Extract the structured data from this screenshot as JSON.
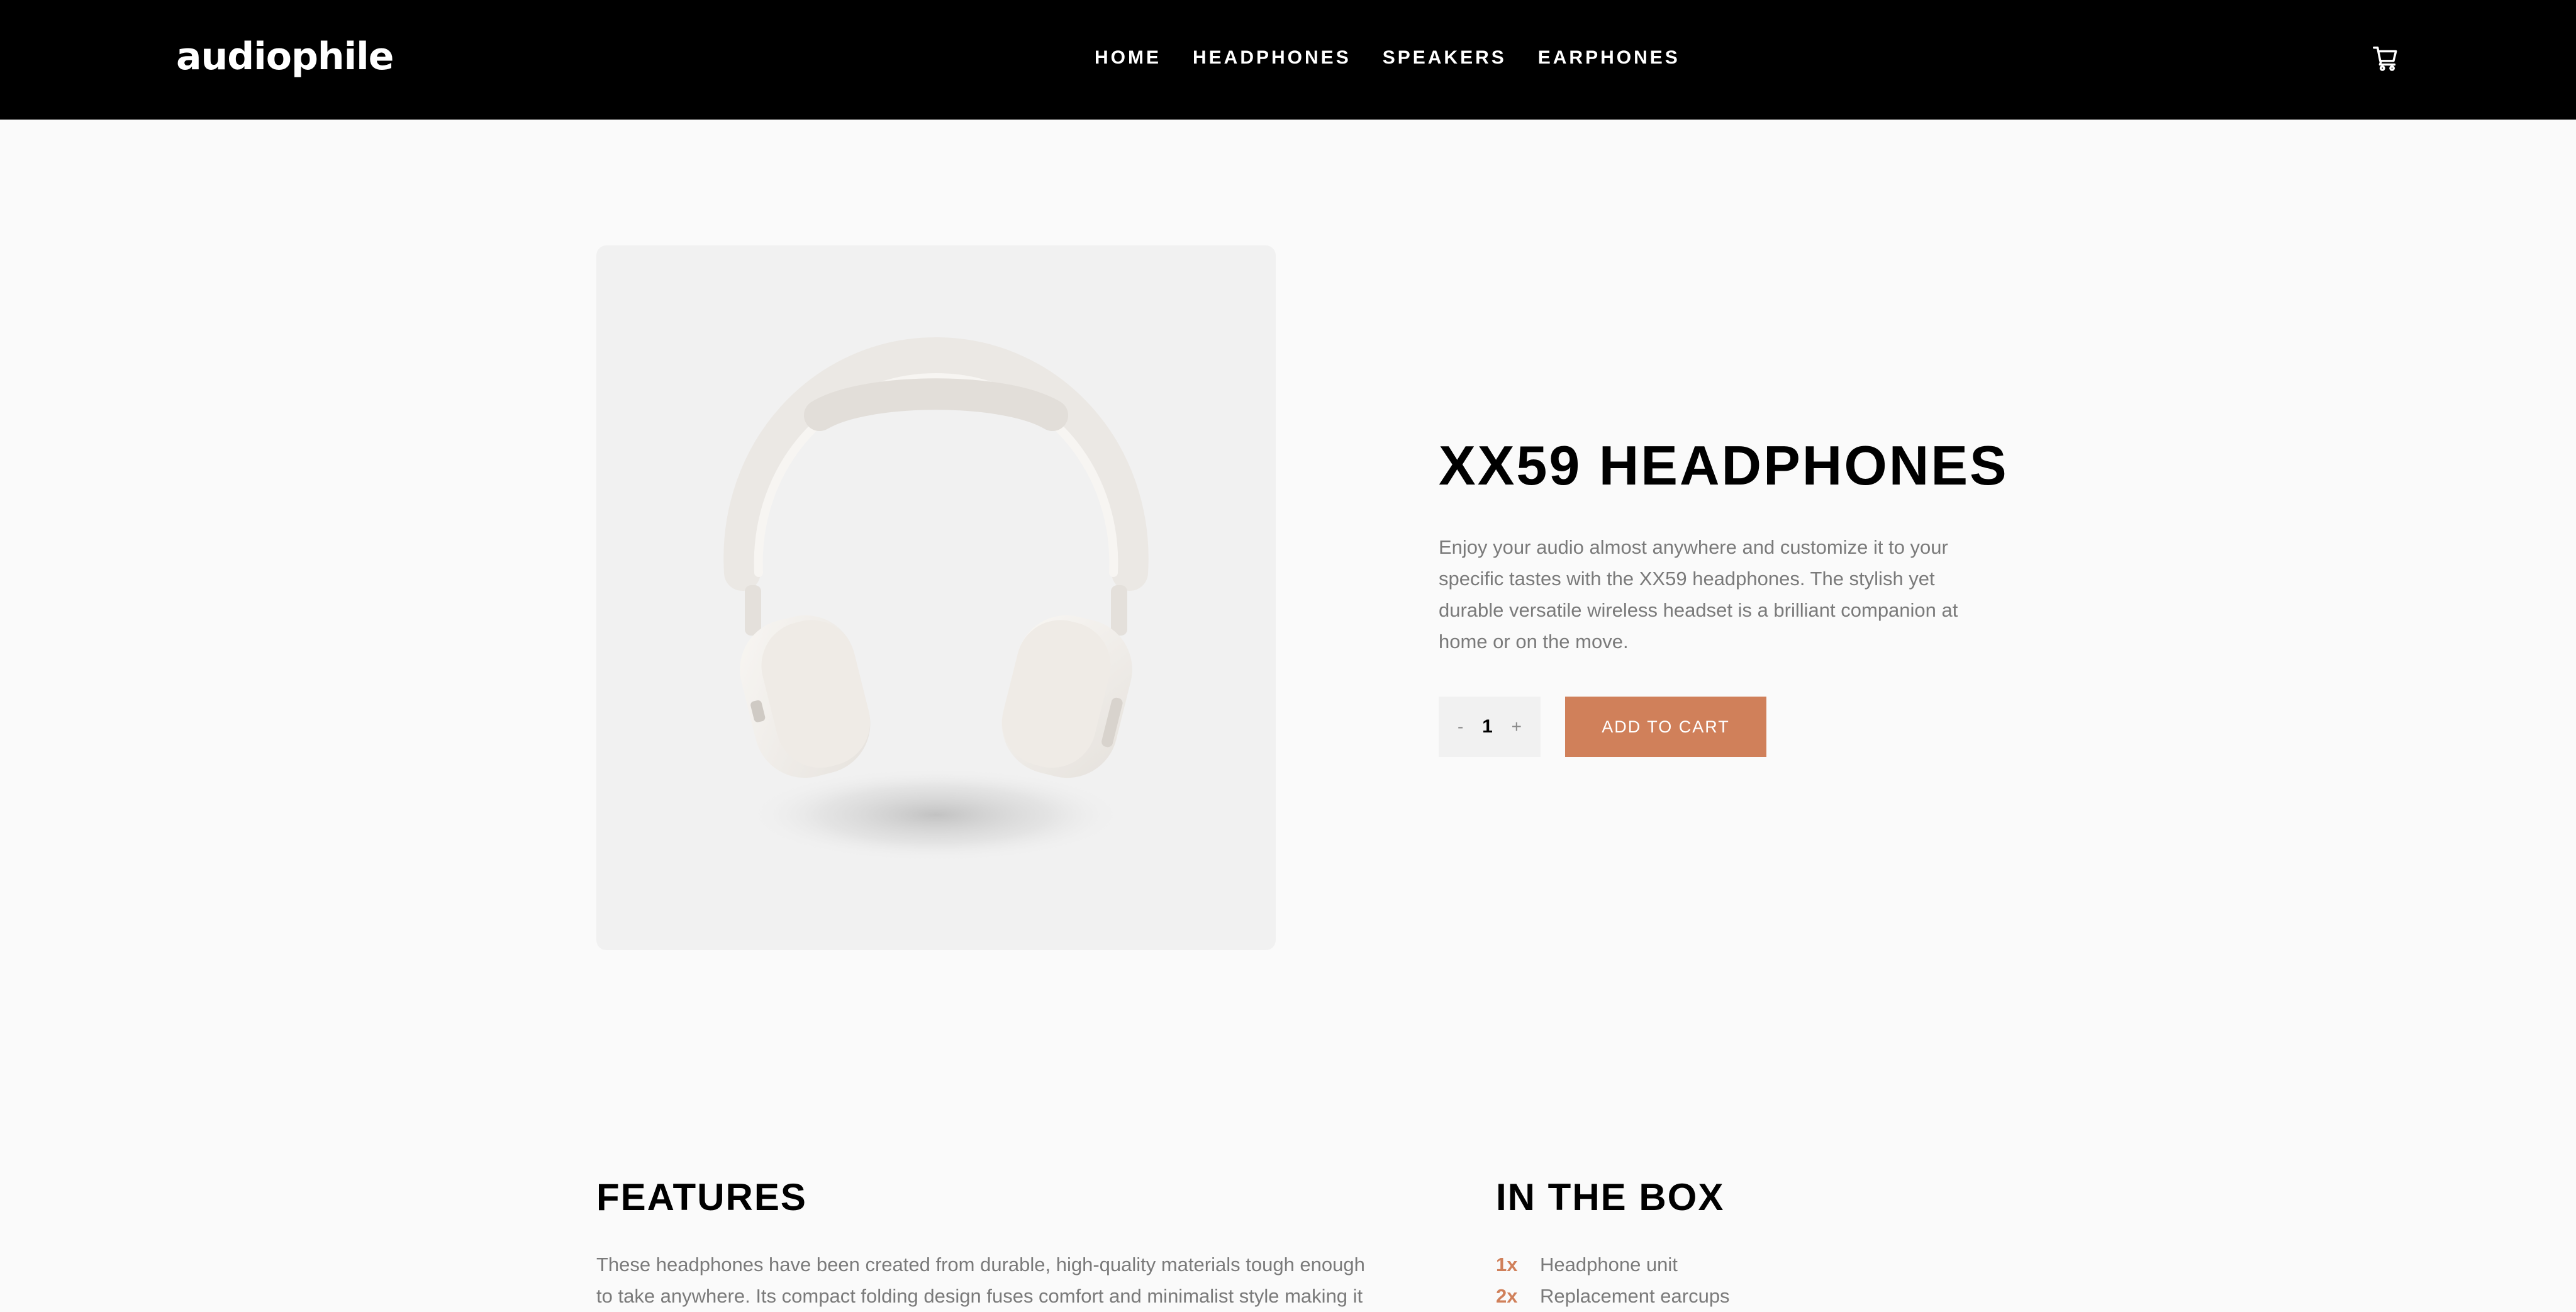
{
  "header": {
    "logo": "audiophile",
    "nav": [
      "HOME",
      "HEADPHONES",
      "SPEAKERS",
      "EARPHONES"
    ],
    "cart_icon": "cart-icon"
  },
  "product": {
    "title": "XX59 HEADPHONES",
    "description": "Enjoy your audio almost anywhere and customize it to your specific tastes with the XX59 headphones. The stylish yet durable versatile wireless headset is a brilliant companion at home or on the move.",
    "quantity": {
      "decrement": "-",
      "value": "1",
      "increment": "+"
    },
    "add_to_cart": "ADD TO CART",
    "image_icon": "headphones-image"
  },
  "features": {
    "heading": "FEATURES",
    "text": "These headphones have been created from durable, high-quality materials tough enough to take anywhere. Its compact folding design fuses comfort and minimalist style making it"
  },
  "in_the_box": {
    "heading": "IN THE BOX",
    "items": [
      {
        "qty": "1x",
        "name": "Headphone unit"
      },
      {
        "qty": "2x",
        "name": "Replacement earcups"
      }
    ]
  },
  "colors": {
    "accent": "#D87D4A",
    "header_bg": "#000000",
    "page_bg": "#FAFAFA",
    "image_bg": "#F1F1F1",
    "body_text": "#7A7A7A"
  }
}
